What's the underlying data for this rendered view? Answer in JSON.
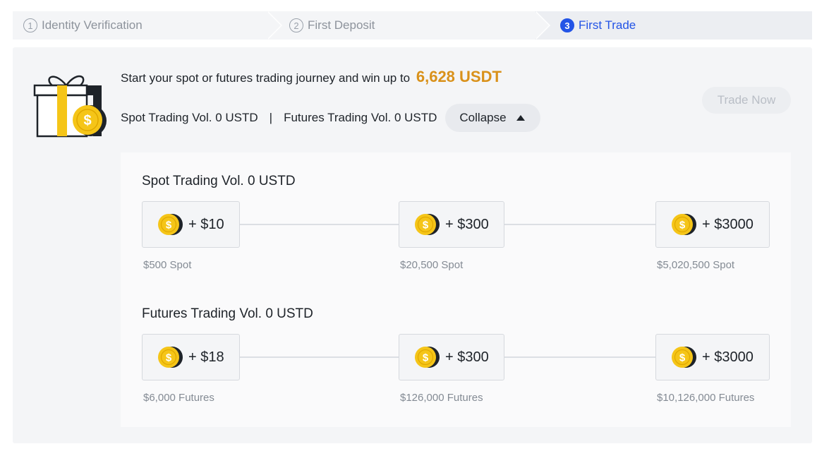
{
  "stepper": {
    "steps": [
      {
        "number": "1",
        "label": "Identity Verification",
        "state": "inactive"
      },
      {
        "number": "2",
        "label": "First Deposit",
        "state": "inactive"
      },
      {
        "number": "3",
        "label": "First Trade",
        "state": "active"
      }
    ]
  },
  "banner": {
    "headline": "Start your spot or futures trading journey and win up to",
    "reward_amount": "6,628 USDT",
    "spot_volume": "Spot Trading Vol. 0 USTD",
    "separator": "|",
    "futures_volume": "Futures Trading Vol. 0 USTD",
    "collapse_label": "Collapse",
    "trade_now_label": "Trade Now",
    "trade_now_enabled": false,
    "icon": "gift-icon"
  },
  "spot": {
    "title": "Spot Trading Vol. 0 USTD",
    "tiers": [
      {
        "reward": "+ $10",
        "requirement": "$500 Spot"
      },
      {
        "reward": "+ $300",
        "requirement": "$20,500 Spot"
      },
      {
        "reward": "+ $3000",
        "requirement": "$5,020,500 Spot"
      }
    ]
  },
  "futures": {
    "title": "Futures Trading Vol. 0 USTD",
    "tiers": [
      {
        "reward": "+ $18",
        "requirement": "$6,000 Futures"
      },
      {
        "reward": "+ $300",
        "requirement": "$126,000 Futures"
      },
      {
        "reward": "+ $3000",
        "requirement": "$10,126,000 Futures"
      }
    ]
  },
  "colors": {
    "accent_blue": "#2354e6",
    "reward_gold": "#d9911a",
    "coin_yellow": "#f5c518",
    "panel_bg": "#f4f5f7"
  }
}
